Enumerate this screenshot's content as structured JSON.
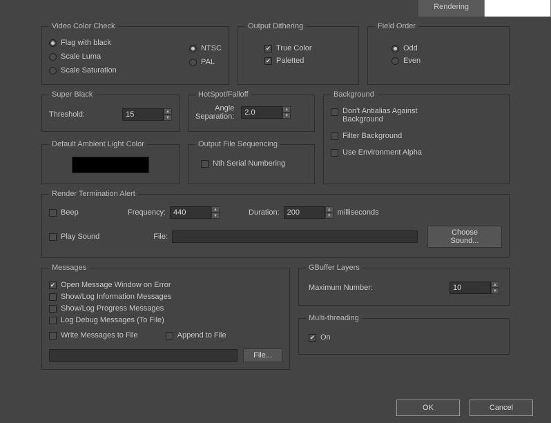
{
  "tabs": {
    "rendering": "Rendering"
  },
  "videoColorCheck": {
    "legend": "Video Color Check",
    "flag": "Flag with black",
    "scaleLuma": "Scale Luma",
    "scaleSat": "Scale Saturation",
    "ntsc": "NTSC",
    "pal": "PAL"
  },
  "outputDithering": {
    "legend": "Output Dithering",
    "trueColor": "True Color",
    "paletted": "Paletted"
  },
  "fieldOrder": {
    "legend": "Field Order",
    "odd": "Odd",
    "even": "Even"
  },
  "superBlack": {
    "legend": "Super Black",
    "threshold": "Threshold:",
    "value": "15"
  },
  "hotspot": {
    "legend": "HotSpot/Falloff",
    "angle": "Angle",
    "sep": "Separation:",
    "value": "2.0"
  },
  "background": {
    "legend": "Background",
    "antialias": "Don't Antialias Against Background",
    "filter": "Filter Background",
    "envAlpha": "Use Environment Alpha"
  },
  "dalc": {
    "legend": "Default Ambient Light Color"
  },
  "ofs": {
    "legend": "Output File Sequencing",
    "nth": "Nth Serial Numbering"
  },
  "rta": {
    "legend": "Render Termination Alert",
    "beep": "Beep",
    "frequency": "Frequency:",
    "freqVal": "440",
    "duration": "Duration:",
    "durVal": "200",
    "ms": "milliseconds",
    "playSound": "Play Sound",
    "file": "File:",
    "chooseSound": "Choose Sound..."
  },
  "messages": {
    "legend": "Messages",
    "openMsg": "Open Message Window on Error",
    "showInfo": "Show/Log Information Messages",
    "showProg": "Show/Log Progress Messages",
    "logDebug": "Log Debug Messages (To File)",
    "writeMsg": "Write Messages to File",
    "append": "Append to File",
    "fileBtn": "File..."
  },
  "gbuffer": {
    "legend": "GBuffer Layers",
    "max": "Maximum Number:",
    "value": "10"
  },
  "multithread": {
    "legend": "Multi-threading",
    "on": "On"
  },
  "footer": {
    "ok": "OK",
    "cancel": "Cancel"
  }
}
